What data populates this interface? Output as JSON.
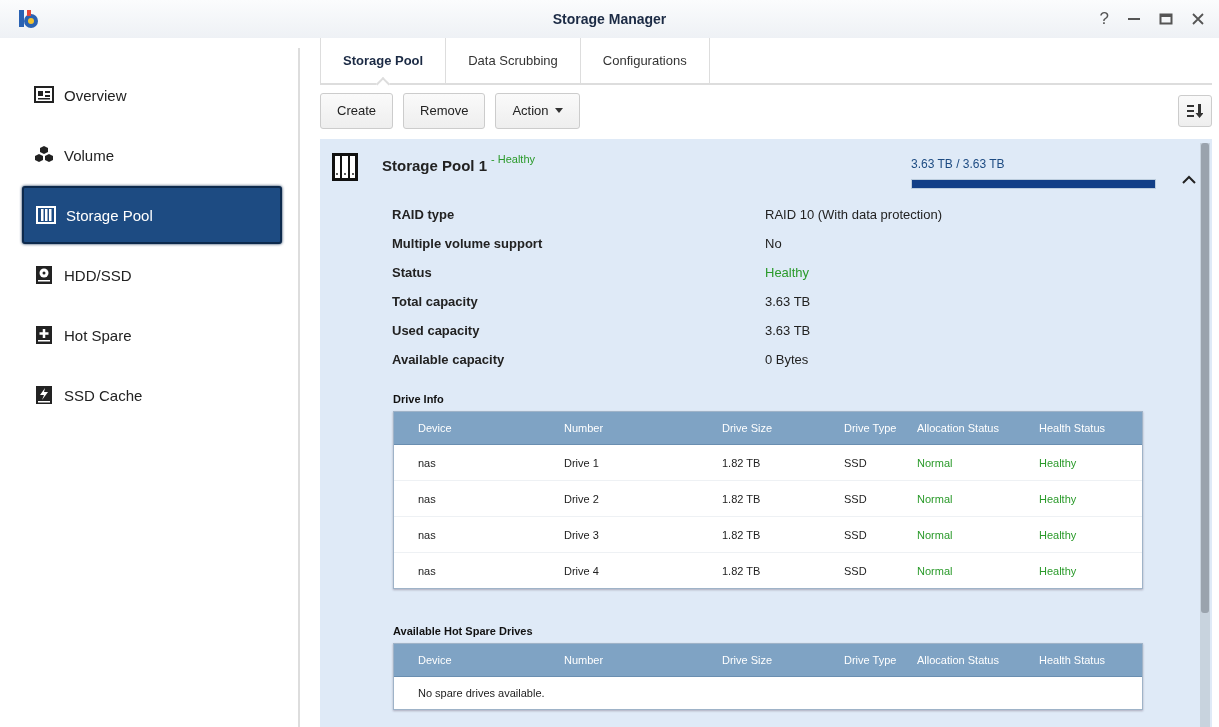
{
  "window": {
    "title": "Storage Manager",
    "controls": [
      "?"
    ]
  },
  "sidebar": {
    "items": [
      {
        "label": "Overview",
        "selected": false
      },
      {
        "label": "Volume",
        "selected": false
      },
      {
        "label": "Storage Pool",
        "selected": true
      },
      {
        "label": "HDD/SSD",
        "selected": false
      },
      {
        "label": "Hot Spare",
        "selected": false
      },
      {
        "label": "SSD Cache",
        "selected": false
      }
    ]
  },
  "tabs": [
    {
      "label": "Storage Pool",
      "selected": true
    },
    {
      "label": "Data Scrubbing",
      "selected": false
    },
    {
      "label": "Configurations",
      "selected": false
    }
  ],
  "toolbar": {
    "buttons": [
      {
        "label": "Create",
        "kind": "plain"
      },
      {
        "label": "Remove",
        "kind": "plain"
      },
      {
        "label": "Action",
        "kind": "menu"
      }
    ]
  },
  "pool": {
    "name": "Storage Pool 1",
    "status": "- Healthy",
    "capacity": "3.63 TB / 3.63 TB",
    "level": 1.0,
    "expanded": true,
    "details": [
      {
        "label": "RAID type",
        "value": "RAID 10 (With data protection)",
        "kind": "text"
      },
      {
        "label": "Multiple volume support",
        "value": "No",
        "kind": "text"
      },
      {
        "label": "Status",
        "value": "Healthy",
        "kind": "status"
      },
      {
        "label": "Total capacity",
        "value": "3.63 TB",
        "kind": "text"
      },
      {
        "label": "Used capacity",
        "value": "3.63 TB",
        "kind": "text"
      },
      {
        "label": "Available capacity",
        "value": "0 Bytes",
        "kind": "text"
      }
    ],
    "drive_info": {
      "title": "Drive Info",
      "columns": [
        {
          "label": "Device",
          "kind": "text"
        },
        {
          "label": "Number",
          "kind": "text"
        },
        {
          "label": "Drive Size",
          "kind": "text"
        },
        {
          "label": "Drive Type",
          "kind": "text"
        },
        {
          "label": "Allocation Status",
          "kind": "status"
        },
        {
          "label": "Health Status",
          "kind": "status"
        }
      ],
      "rows": [
        [
          "nas",
          "Drive 1",
          "1.82 TB",
          "SSD",
          "Normal",
          "Healthy"
        ],
        [
          "nas",
          "Drive 2",
          "1.82 TB",
          "SSD",
          "Normal",
          "Healthy"
        ],
        [
          "nas",
          "Drive 3",
          "1.82 TB",
          "SSD",
          "Normal",
          "Healthy"
        ],
        [
          "nas",
          "Drive 4",
          "1.82 TB",
          "SSD",
          "Normal",
          "Healthy"
        ]
      ]
    },
    "hot_spare": {
      "title": "Available Hot Spare Drives",
      "columns": [
        {
          "label": "Device"
        },
        {
          "label": "Number"
        },
        {
          "label": "Drive Size"
        },
        {
          "label": "Drive Type"
        },
        {
          "label": "Allocation Status"
        },
        {
          "label": "Health Status"
        }
      ],
      "empty_message": "No spare drives available."
    }
  }
}
